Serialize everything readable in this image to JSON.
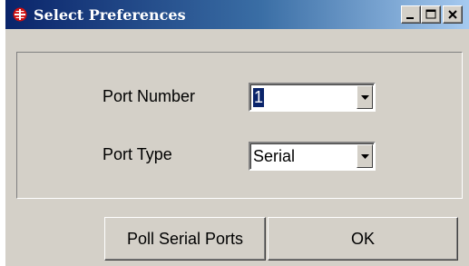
{
  "window": {
    "title": "Select Preferences",
    "title_bar_colors": [
      "#0a246a",
      "#a6caf0"
    ],
    "icons": {
      "app": "app-icon",
      "minimize": "minimize-icon",
      "maximize": "maximize-icon",
      "close": "close-icon"
    }
  },
  "form": {
    "port_number": {
      "label": "Port Number",
      "value": "1"
    },
    "port_type": {
      "label": "Port Type",
      "value": "Serial"
    }
  },
  "buttons": {
    "poll_label": "Poll Serial Ports",
    "ok_label": "OK"
  }
}
